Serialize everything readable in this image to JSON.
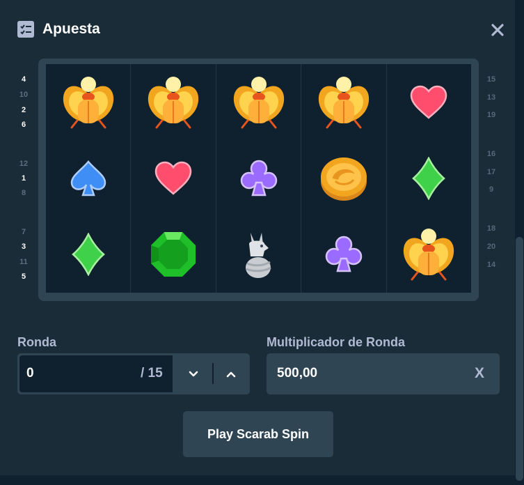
{
  "header": {
    "title": "Apuesta",
    "icon": "checklist-icon",
    "close_icon": "close-icon"
  },
  "reels": {
    "columns": [
      [
        "scarab",
        "spade",
        "diamond-suit"
      ],
      [
        "scarab",
        "heart",
        "emerald"
      ],
      [
        "scarab",
        "club",
        "anubis"
      ],
      [
        "scarab",
        "gold-coin",
        "club"
      ],
      [
        "heart",
        "diamond-suit",
        "scarab"
      ]
    ]
  },
  "paylines": {
    "left": [
      "4",
      "10",
      "2",
      "6",
      "12",
      "1",
      "8",
      "7",
      "3",
      "11",
      "5"
    ],
    "right": [
      "15",
      "13",
      "19",
      "16",
      "17",
      "9",
      "18",
      "20",
      "14"
    ]
  },
  "round": {
    "label": "Ronda",
    "value": "0",
    "total": "/ 15",
    "down_icon": "chevron-down-icon",
    "up_icon": "chevron-up-icon"
  },
  "multiplier": {
    "label": "Multiplicador de Ronda",
    "value": "500,00",
    "suffix": "X"
  },
  "play_button": {
    "label": "Play Scarab Spin"
  },
  "colors": {
    "background": "#1a2c38",
    "panel": "#2f4553",
    "input": "#0f212e",
    "muted_text": "#b1bad3",
    "heart": "#ff4d6d",
    "spade": "#3f8ef5",
    "club": "#9b6bff",
    "diamond": "#3fd14a",
    "emerald": "#1fbf2a",
    "gold": "#f2a51e"
  }
}
